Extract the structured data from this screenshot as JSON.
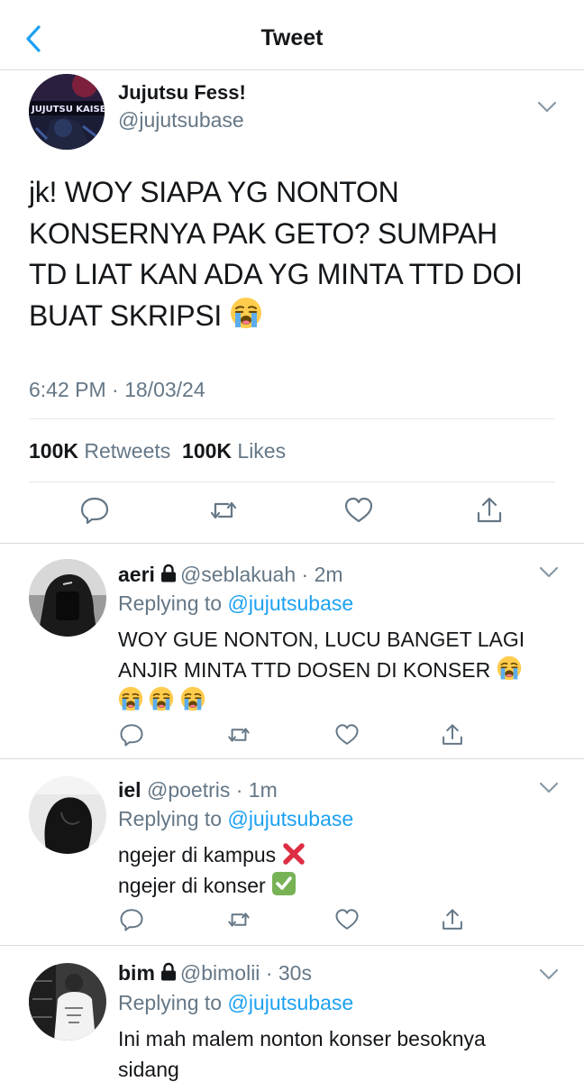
{
  "nav": {
    "title": "Tweet",
    "back_icon": "chevron-left-icon"
  },
  "colors": {
    "link": "#1da1f2",
    "muted": "#657786",
    "text": "#14171a",
    "divider": "#d6dade",
    "cross": "#dd2e44",
    "check": "#77b255"
  },
  "main_tweet": {
    "name": "Jujutsu Fess!",
    "handle": "@jujutsubase",
    "text_lines": [
      "jk! WOY SIAPA YG NONTON",
      "KONSERNYA PAK GETO? SUMPAH",
      "TD LIAT KAN ADA YG MINTA TTD DOI",
      "BUAT SKRIPSI"
    ],
    "emoji": "loudly-crying-face",
    "time": "6:42 PM · 18/03/24",
    "retweets_count": "100K",
    "retweets_label": "Retweets",
    "likes_count": "100K",
    "likes_label": "Likes",
    "actions": [
      "reply-icon",
      "retweet-icon",
      "like-icon",
      "share-icon"
    ]
  },
  "replies": [
    {
      "name": "aeri",
      "locked": true,
      "handle": "@seblakuah",
      "time": "· 2m",
      "replying_prefix": "Replying to",
      "replying_to": "@jujutsubase",
      "text_lines": [
        "WOY GUE NONTON, LUCU BANGET LAGI",
        "ANJIR MINTA TTD DOSEN DI KONSER"
      ],
      "emoji": "loudly-crying-face"
    },
    {
      "name": "iel",
      "locked": false,
      "handle": "@poetris",
      "time": "· 1m",
      "replying_prefix": "Replying to",
      "replying_to": "@jujutsubase",
      "text_lines": [
        "ngejer di kampus",
        "ngejer di konser"
      ],
      "emoji": [
        "cross-mark",
        "check-mark-button"
      ]
    },
    {
      "name": "bim",
      "locked": true,
      "handle": "@bimolii",
      "time": "· 30s",
      "replying_prefix": "Replying to",
      "replying_to": "@jujutsubase",
      "text_lines": [
        "Ini mah malem nonton konser besoknya",
        "sidang"
      ]
    }
  ]
}
